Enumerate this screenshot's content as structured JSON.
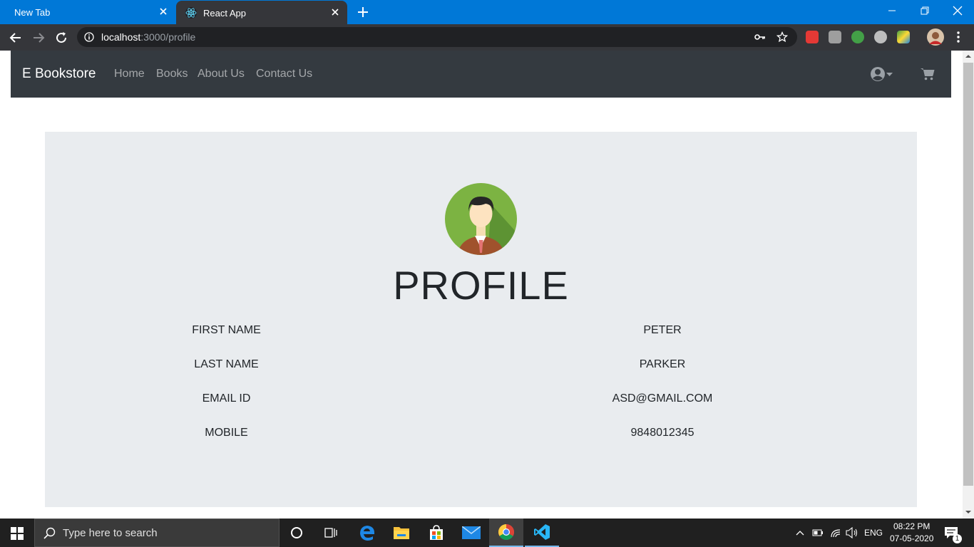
{
  "browser": {
    "tabs": [
      {
        "title": "New Tab"
      },
      {
        "title": "React App"
      }
    ],
    "url_host": "localhost",
    "url_path": ":3000/profile"
  },
  "navbar": {
    "brand": "E Bookstore",
    "links": [
      "Home",
      "Books",
      "About Us",
      "Contact Us"
    ]
  },
  "profile": {
    "title": "PROFILE",
    "fields": [
      {
        "label": "FIRST NAME",
        "value": "PETER"
      },
      {
        "label": "LAST NAME",
        "value": "PARKER"
      },
      {
        "label": "EMAIL ID",
        "value": "ASD@GMAIL.COM"
      },
      {
        "label": "MOBILE",
        "value": "9848012345"
      }
    ]
  },
  "taskbar": {
    "search_placeholder": "Type here to search",
    "language": "ENG",
    "time": "08:22 PM",
    "date": "07-05-2020",
    "notification_count": "1"
  },
  "colors": {
    "titlebar": "#0078d7",
    "navbar": "#343a40",
    "jumbotron": "#e9ecef"
  }
}
